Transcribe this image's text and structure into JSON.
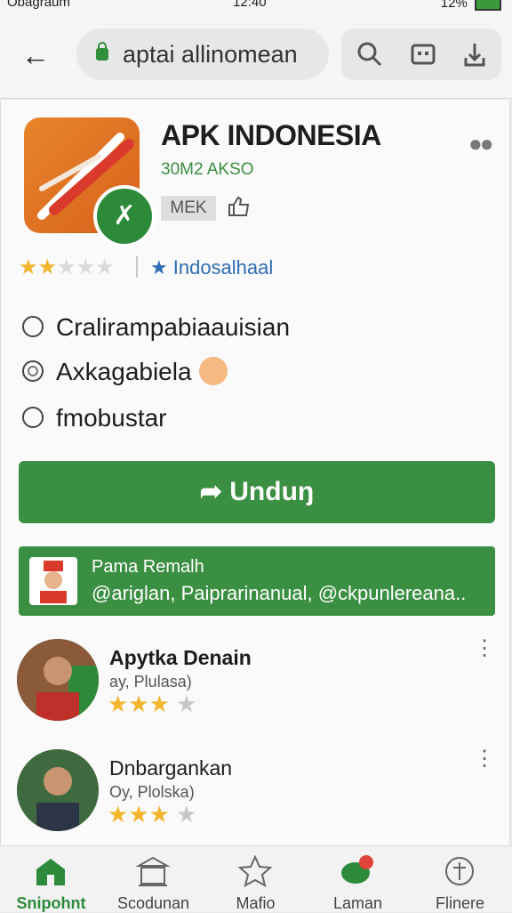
{
  "status": {
    "carrier": "Obagraum",
    "time": "12:40",
    "battery": "12%"
  },
  "browser": {
    "url": "aptai allinomean"
  },
  "app": {
    "title": "APK INDONESIA",
    "subtitle": "30M2 AKSO",
    "tag": "MEK",
    "rating": 2.5,
    "developer": "Indosalhaal"
  },
  "options": [
    {
      "label": "Cralirampabiaauisian",
      "selected": false
    },
    {
      "label": "Axkagabiela",
      "selected": true
    },
    {
      "label": "fmobustar",
      "selected": false
    }
  ],
  "download_label": "Unduŋ",
  "banner": {
    "line1": "Pama Remalh",
    "line2": "@ariglan, Paiprarinanual, @ckpunlereana.."
  },
  "reviews": [
    {
      "name": "Apytka Denain",
      "meta": "ay, Plulasa)",
      "stars": 3
    },
    {
      "name": "Dnbargankan",
      "meta": "Oy, Plolska)",
      "stars": 3
    }
  ],
  "nav": [
    {
      "label": "Snipohnt",
      "icon": "home-icon",
      "active": true
    },
    {
      "label": "Scodunan",
      "icon": "bank-icon",
      "active": false
    },
    {
      "label": "Mafio",
      "icon": "star-icon",
      "active": false
    },
    {
      "label": "Laman",
      "icon": "chat-icon",
      "active": false
    },
    {
      "label": "Flinere",
      "icon": "settings-icon",
      "active": false
    }
  ],
  "colors": {
    "accent": "#3b8f42",
    "star": "#f2b52c",
    "link": "#2d6db5"
  }
}
